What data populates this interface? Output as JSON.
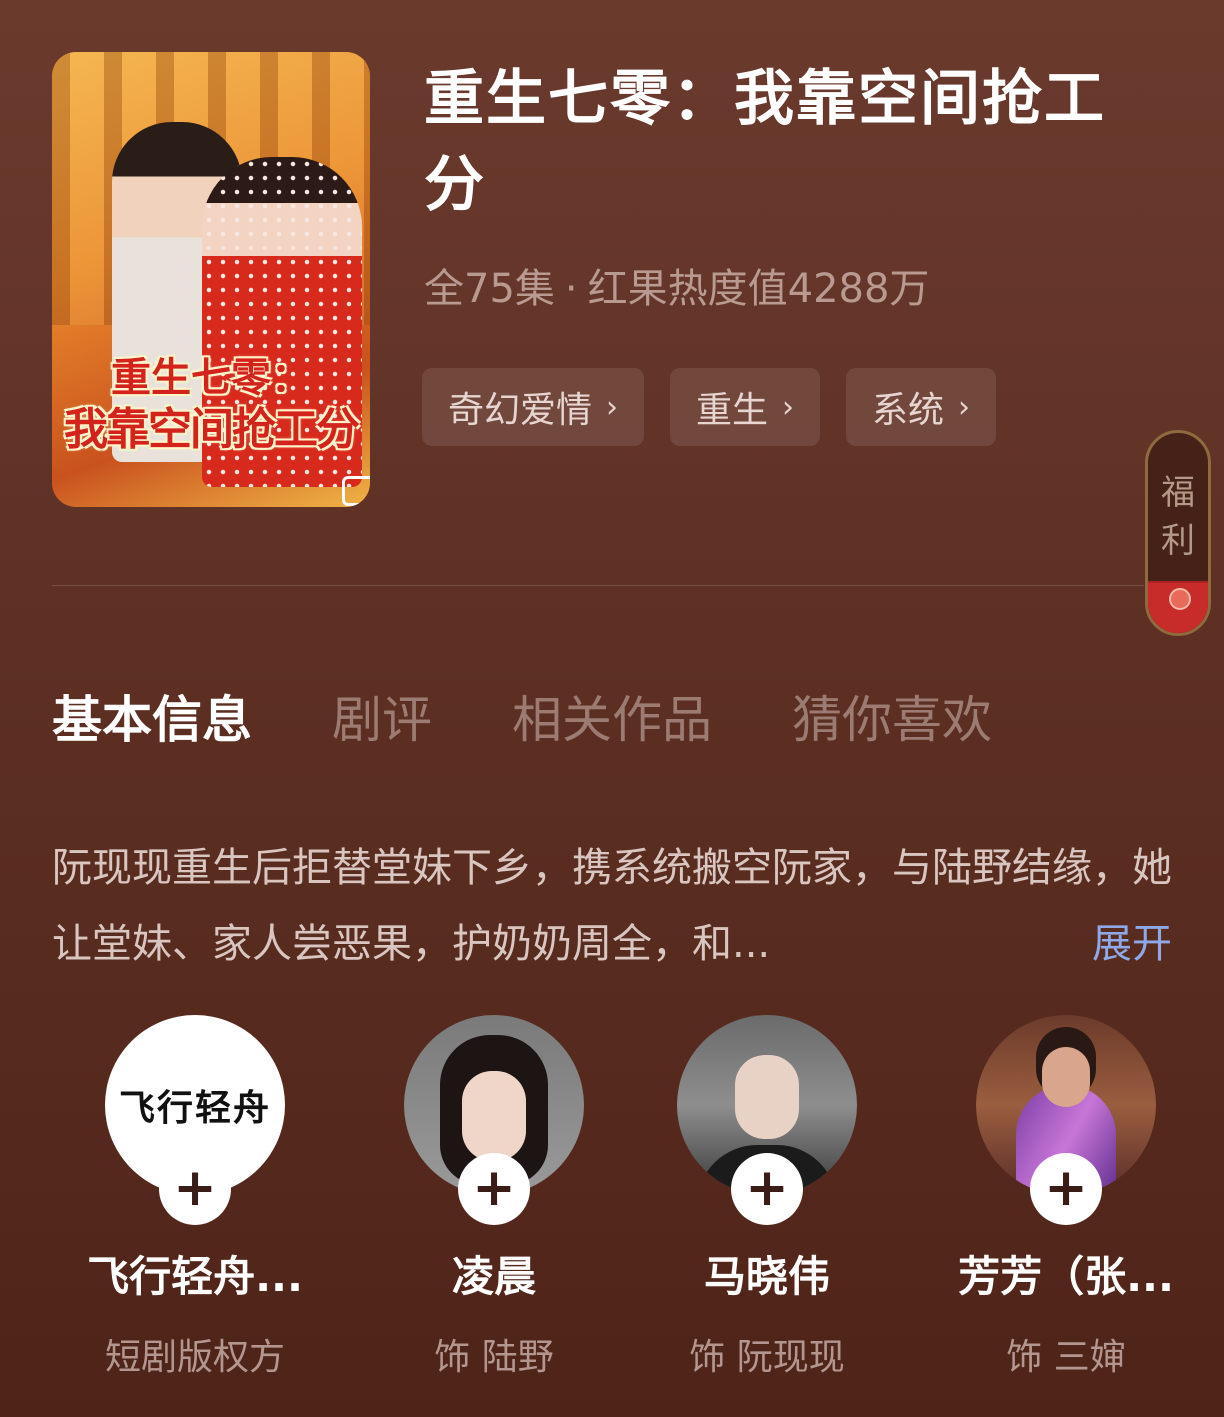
{
  "drama": {
    "poster_title_line1": "重生七零：",
    "poster_title_line2": "我靠空间抢工分",
    "title": "重生七零：我靠空间抢工分",
    "episodes": "全75集",
    "separator": "·",
    "heat": "红果热度值4288万",
    "tags": [
      "奇幻爱情",
      "重生",
      "系统"
    ],
    "tag_chevron": "›"
  },
  "side_badge": {
    "line1": "福",
    "line2": "利"
  },
  "tabs": [
    "基本信息",
    "剧评",
    "相关作品",
    "猜你喜欢"
  ],
  "description": {
    "text": "阮现现重生后拒替堂妹下乡，携系统搬空阮家，与陆野结缘，她让堂妹、家人尝恶果，护奶奶周全，和...",
    "expand_label": "展开"
  },
  "cast": [
    {
      "name": "飞行轻舟...",
      "role": "短剧版权方",
      "avatar_text": "飞行轻舟"
    },
    {
      "name": "凌晨",
      "role": "饰 陆野"
    },
    {
      "name": "马晓伟",
      "role": "饰 阮现现"
    },
    {
      "name": "芳芳（张...",
      "role": "饰 三婶"
    }
  ],
  "follow_symbol": "+",
  "colors": {
    "background": "#5e3024",
    "accent_link": "#8fa8e8",
    "poster_red": "#d3231a"
  }
}
